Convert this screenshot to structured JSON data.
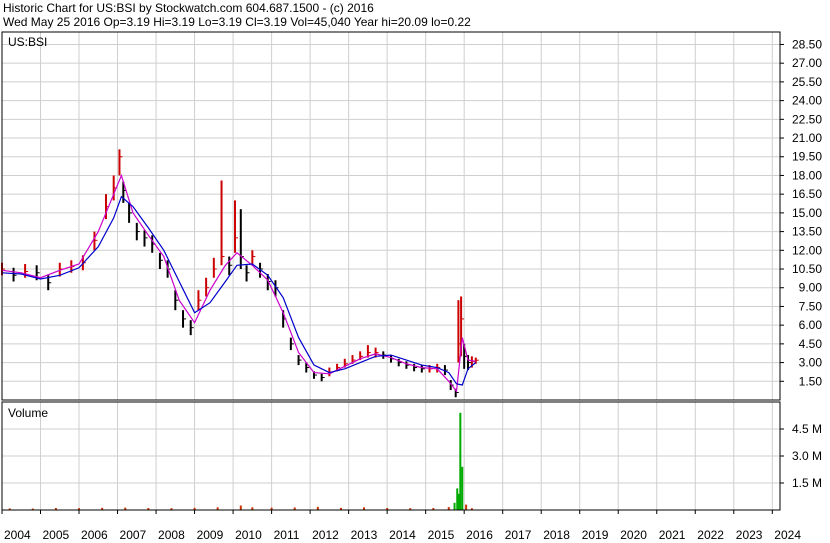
{
  "header": {
    "title_line": "Historic Chart for US:BSI by Stockwatch.com 604.687.1500 - (c) 2016",
    "quote_line": "Wed May 25 2016   Op=3.19  Hi=3.19  Lo=3.19  Cl=3.19  Vol=45,040  Year hi=20.09  lo=0.22"
  },
  "colors": {
    "background": "#ffffff",
    "grid": "#cfcfcf",
    "axis": "#000000",
    "price_bars_up": "#cc0000",
    "price_bars_down": "#000000",
    "moving_average_short": "#cc00cc",
    "moving_average_long": "#0000cc",
    "volume_bars": "#00aa00",
    "volume_bars_small": "#cc3300"
  },
  "chart_data": [
    {
      "type": "line",
      "panel": "price",
      "title": "US:BSI",
      "xlabel": "",
      "ylabel": "",
      "ylim": [
        0,
        29.5
      ],
      "y_ticks": [
        "28.50",
        "27.00",
        "25.50",
        "24.00",
        "22.50",
        "21.00",
        "19.50",
        "18.00",
        "16.50",
        "15.00",
        "13.50",
        "12.00",
        "10.50",
        "9.00",
        "7.50",
        "6.00",
        "4.50",
        "3.00",
        "1.50"
      ],
      "x_ticks": [
        "2004",
        "2005",
        "2006",
        "2007",
        "2008",
        "2009",
        "2010",
        "2011",
        "2012",
        "2013",
        "2014",
        "2015",
        "2016",
        "2017",
        "2018",
        "2019",
        "2020",
        "2021",
        "2022",
        "2023",
        "2024"
      ],
      "xlim": [
        2004.0,
        2024.2
      ],
      "grid": true,
      "series": [
        {
          "style": "high-low bars (close)",
          "x": [
            2004.0,
            2004.3,
            2004.6,
            2004.9,
            2005.2,
            2005.5,
            2005.8,
            2006.1,
            2006.4,
            2006.7,
            2006.9,
            2007.05,
            2007.15,
            2007.3,
            2007.5,
            2007.7,
            2007.9,
            2008.1,
            2008.3,
            2008.5,
            2008.7,
            2008.9,
            2009.1,
            2009.3,
            2009.5,
            2009.7,
            2009.9,
            2010.05,
            2010.2,
            2010.35,
            2010.5,
            2010.7,
            2010.9,
            2011.1,
            2011.3,
            2011.5,
            2011.7,
            2011.9,
            2012.1,
            2012.3,
            2012.5,
            2012.7,
            2012.9,
            2013.1,
            2013.3,
            2013.5,
            2013.7,
            2013.9,
            2014.1,
            2014.3,
            2014.5,
            2014.7,
            2014.9,
            2015.1,
            2015.3,
            2015.5,
            2015.65,
            2015.78,
            2015.85,
            2015.92,
            2016.0,
            2016.1,
            2016.2,
            2016.3
          ],
          "values": [
            10.5,
            10.0,
            10.3,
            10.2,
            9.4,
            10.5,
            10.7,
            11.0,
            12.8,
            15.5,
            17.0,
            19.5,
            16.8,
            15.0,
            13.5,
            13.0,
            12.5,
            11.2,
            10.5,
            8.0,
            6.5,
            5.8,
            8.0,
            9.0,
            10.5,
            11.5,
            10.8,
            13.0,
            11.5,
            10.2,
            11.5,
            10.5,
            9.5,
            9.0,
            6.5,
            4.5,
            3.2,
            2.6,
            2.0,
            1.8,
            2.2,
            2.6,
            2.9,
            3.2,
            3.5,
            3.8,
            3.8,
            3.6,
            3.3,
            3.0,
            2.8,
            2.6,
            2.5,
            2.5,
            2.6,
            2.4,
            1.2,
            0.6,
            4.5,
            6.5,
            3.5,
            3.0,
            3.1,
            3.19
          ],
          "highs": [
            11.0,
            10.6,
            10.9,
            10.8,
            10.0,
            11.0,
            11.2,
            11.6,
            13.5,
            16.5,
            18.0,
            20.09,
            17.5,
            15.8,
            14.2,
            13.6,
            13.2,
            11.8,
            11.2,
            8.8,
            7.2,
            6.4,
            8.8,
            9.8,
            11.4,
            17.6,
            11.5,
            16.0,
            15.3,
            10.8,
            12.0,
            11.0,
            10.1,
            9.6,
            7.2,
            5.0,
            3.6,
            3.0,
            2.3,
            2.1,
            2.6,
            2.9,
            3.3,
            3.6,
            3.9,
            4.4,
            4.2,
            3.9,
            3.6,
            3.3,
            3.1,
            2.9,
            2.8,
            2.8,
            2.9,
            2.8,
            1.6,
            0.9,
            8.0,
            8.3,
            4.5,
            3.6,
            3.5,
            3.4
          ],
          "lows": [
            10.0,
            9.5,
            9.8,
            9.6,
            8.8,
            9.9,
            10.2,
            10.4,
            12.0,
            14.5,
            16.0,
            18.0,
            15.8,
            14.2,
            12.8,
            12.3,
            11.8,
            10.5,
            9.8,
            7.2,
            5.8,
            5.2,
            7.2,
            8.3,
            9.8,
            10.8,
            10.0,
            11.8,
            10.5,
            9.5,
            10.8,
            9.8,
            8.8,
            8.3,
            5.8,
            4.0,
            2.8,
            2.2,
            1.7,
            1.5,
            1.9,
            2.3,
            2.6,
            2.9,
            3.2,
            3.4,
            3.4,
            3.3,
            3.0,
            2.7,
            2.5,
            2.3,
            2.2,
            2.2,
            2.2,
            2.0,
            0.8,
            0.22,
            3.0,
            3.5,
            2.5,
            2.4,
            2.6,
            2.9
          ]
        },
        {
          "style": "moving average short",
          "x": [
            2004.0,
            2004.5,
            2005.0,
            2005.5,
            2006.0,
            2006.5,
            2006.9,
            2007.1,
            2007.4,
            2007.8,
            2008.2,
            2008.6,
            2009.0,
            2009.4,
            2009.8,
            2010.1,
            2010.5,
            2010.9,
            2011.3,
            2011.7,
            2012.1,
            2012.5,
            2012.9,
            2013.3,
            2013.7,
            2014.1,
            2014.5,
            2014.9,
            2015.3,
            2015.6,
            2015.8,
            2015.95,
            2016.1,
            2016.3
          ],
          "values": [
            10.4,
            10.2,
            9.8,
            10.4,
            10.9,
            13.5,
            16.5,
            18.0,
            15.0,
            13.2,
            11.5,
            8.0,
            6.2,
            8.8,
            10.8,
            11.8,
            10.8,
            9.6,
            7.0,
            3.8,
            2.2,
            2.1,
            2.7,
            3.3,
            3.7,
            3.4,
            2.9,
            2.6,
            2.5,
            1.5,
            0.7,
            5.0,
            3.2,
            3.1
          ]
        },
        {
          "style": "moving average long",
          "x": [
            2004.0,
            2004.5,
            2005.0,
            2005.5,
            2006.0,
            2006.5,
            2006.9,
            2007.1,
            2007.4,
            2007.8,
            2008.2,
            2008.6,
            2009.0,
            2009.4,
            2009.8,
            2010.1,
            2010.5,
            2010.9,
            2011.3,
            2011.7,
            2012.1,
            2012.5,
            2012.9,
            2013.3,
            2013.7,
            2014.1,
            2014.5,
            2014.9,
            2015.3,
            2015.6,
            2015.8,
            2015.95,
            2016.1,
            2016.3
          ],
          "values": [
            10.2,
            10.1,
            9.7,
            10.0,
            10.6,
            12.3,
            14.6,
            16.3,
            15.5,
            13.8,
            12.0,
            9.5,
            7.0,
            7.8,
            9.5,
            10.8,
            10.9,
            10.0,
            8.2,
            5.0,
            2.8,
            2.2,
            2.5,
            3.0,
            3.5,
            3.6,
            3.2,
            2.8,
            2.6,
            2.2,
            1.3,
            1.2,
            2.5,
            3.0
          ]
        }
      ]
    },
    {
      "type": "bar",
      "panel": "volume",
      "title": "Volume",
      "xlabel": "",
      "ylabel": "",
      "ylim": [
        0,
        6000000
      ],
      "y_ticks": [
        "4.5 M",
        "3.0 M",
        "1.5 M"
      ],
      "x_ticks": [
        "2004",
        "2005",
        "2006",
        "2007",
        "2008",
        "2009",
        "2010",
        "2011",
        "2012",
        "2013",
        "2014",
        "2015",
        "2016",
        "2017",
        "2018",
        "2019",
        "2020",
        "2021",
        "2022",
        "2023",
        "2024"
      ],
      "xlim": [
        2004.0,
        2024.2
      ],
      "grid": true,
      "x": [
        2004.2,
        2004.8,
        2005.4,
        2006.0,
        2006.6,
        2007.2,
        2007.8,
        2008.4,
        2009.0,
        2009.6,
        2010.2,
        2010.5,
        2011.0,
        2011.6,
        2012.2,
        2012.8,
        2013.4,
        2014.0,
        2014.6,
        2015.2,
        2015.6,
        2015.75,
        2015.82,
        2015.86,
        2015.9,
        2015.95,
        2016.05,
        2016.2
      ],
      "values": [
        90000,
        80000,
        110000,
        100000,
        120000,
        130000,
        110000,
        100000,
        120000,
        150000,
        250000,
        150000,
        130000,
        140000,
        170000,
        120000,
        150000,
        110000,
        100000,
        110000,
        160000,
        400000,
        1200000,
        900000,
        5400000,
        2400000,
        300000,
        100000
      ]
    }
  ]
}
